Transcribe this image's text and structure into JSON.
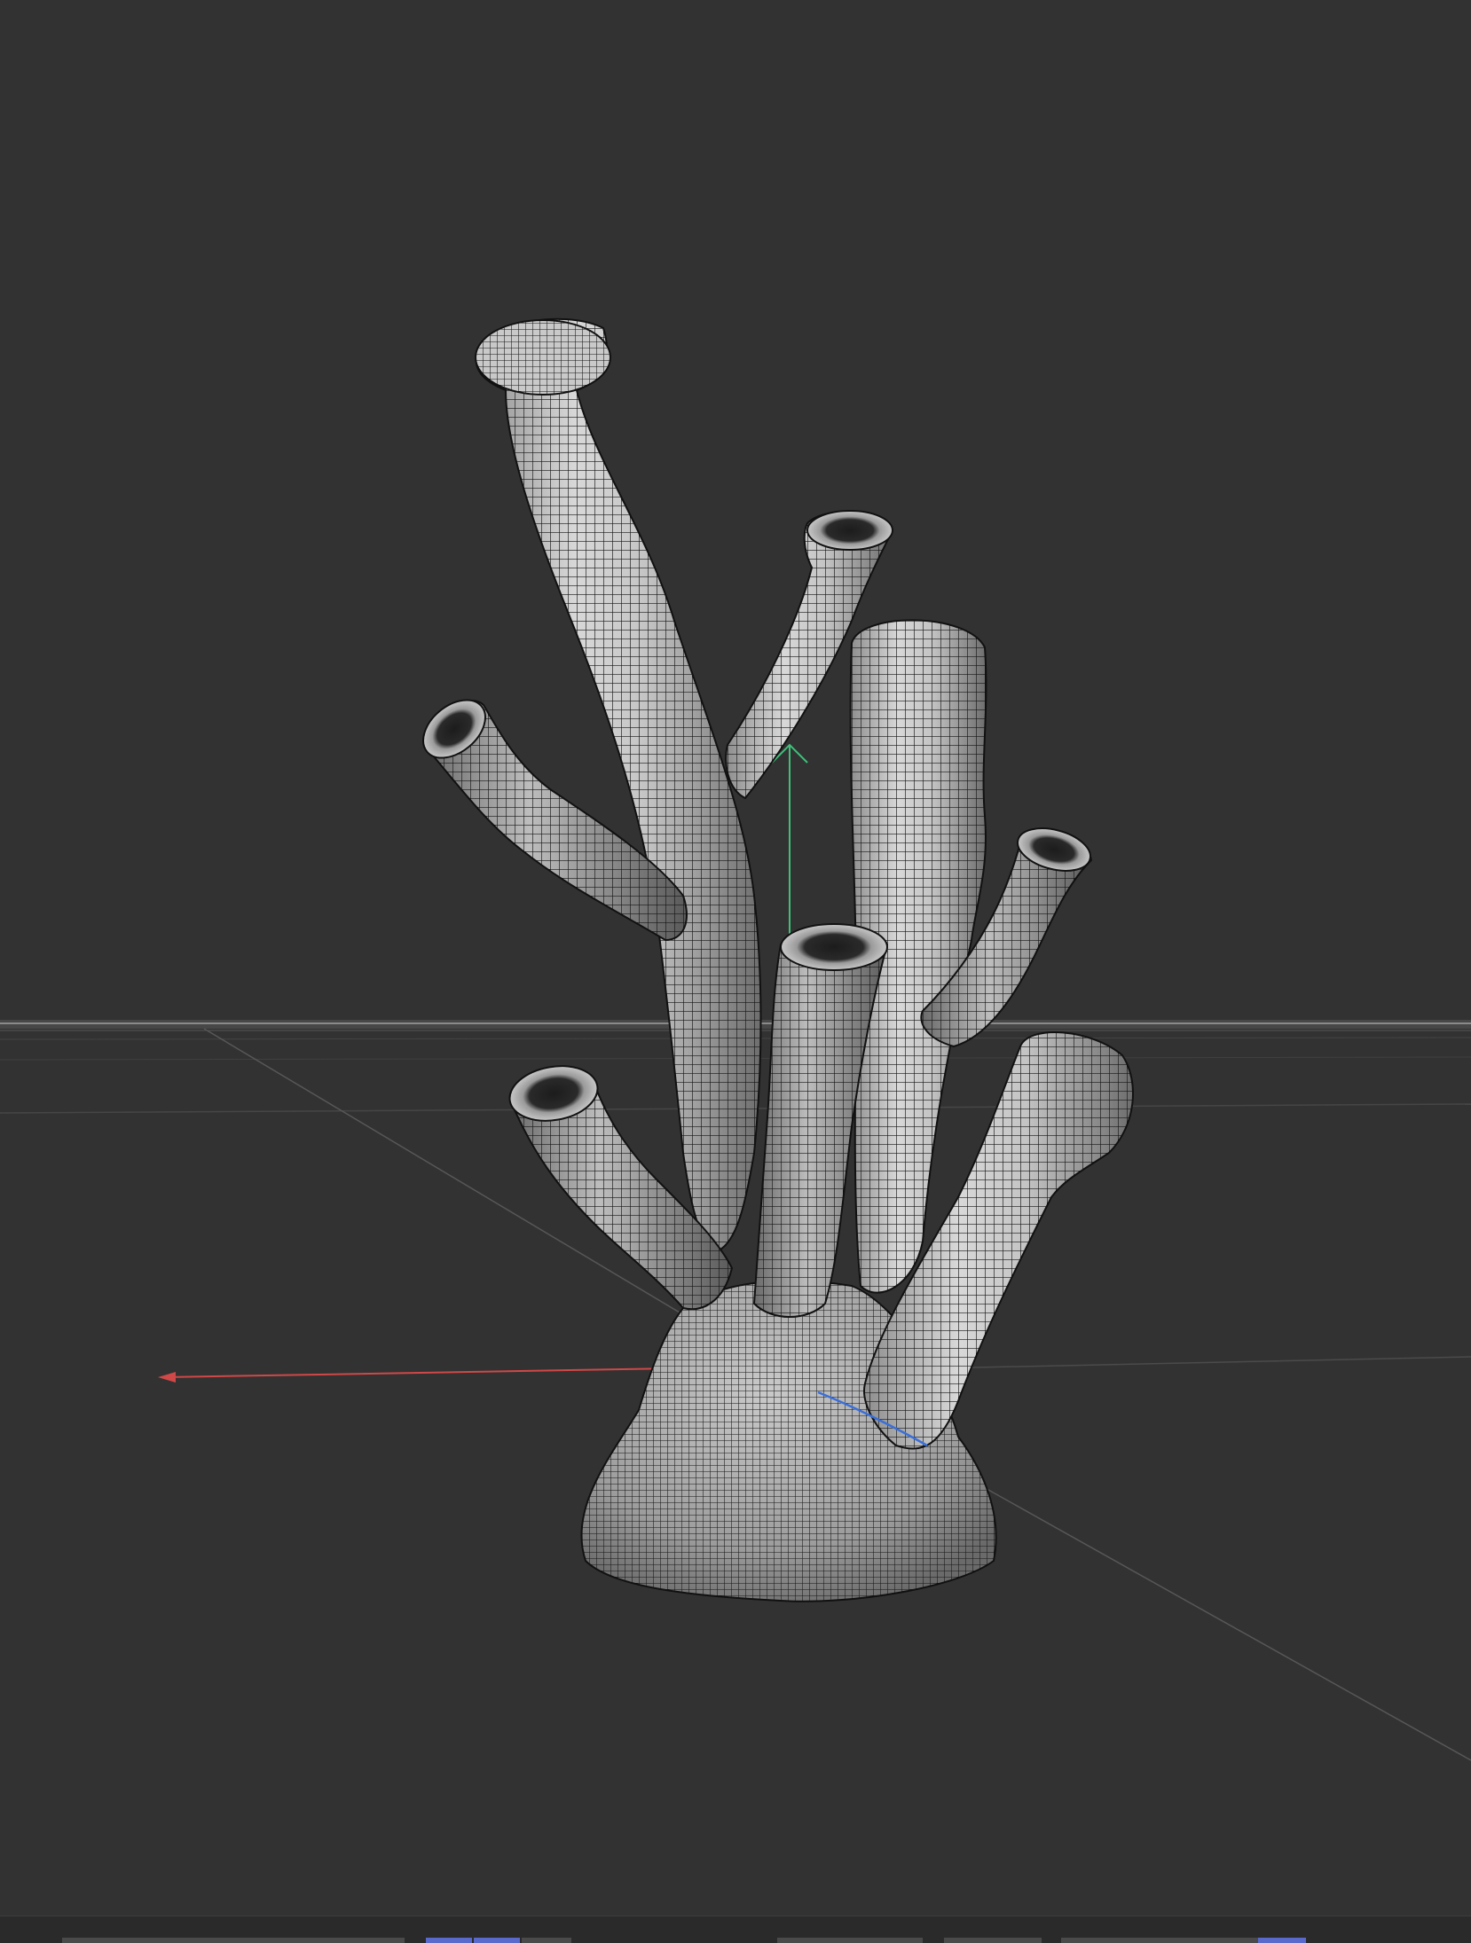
{
  "viewport": {
    "background": "#323232",
    "object": "coral-mesh",
    "display_mode": "wireframe-shaded",
    "axes": {
      "x_color": "#d04848",
      "y_color": "#3fbf7a",
      "z_color": "#3a6fd8"
    }
  },
  "bottom_bar": {
    "segments": [
      {
        "name": "segment-1",
        "active": false
      },
      {
        "name": "segment-2",
        "active": true
      },
      {
        "name": "segment-3",
        "active": true
      },
      {
        "name": "segment-4",
        "active": false
      },
      {
        "name": "segment-5",
        "active": false
      },
      {
        "name": "segment-6",
        "active": false
      },
      {
        "name": "segment-7",
        "active": true
      }
    ]
  }
}
